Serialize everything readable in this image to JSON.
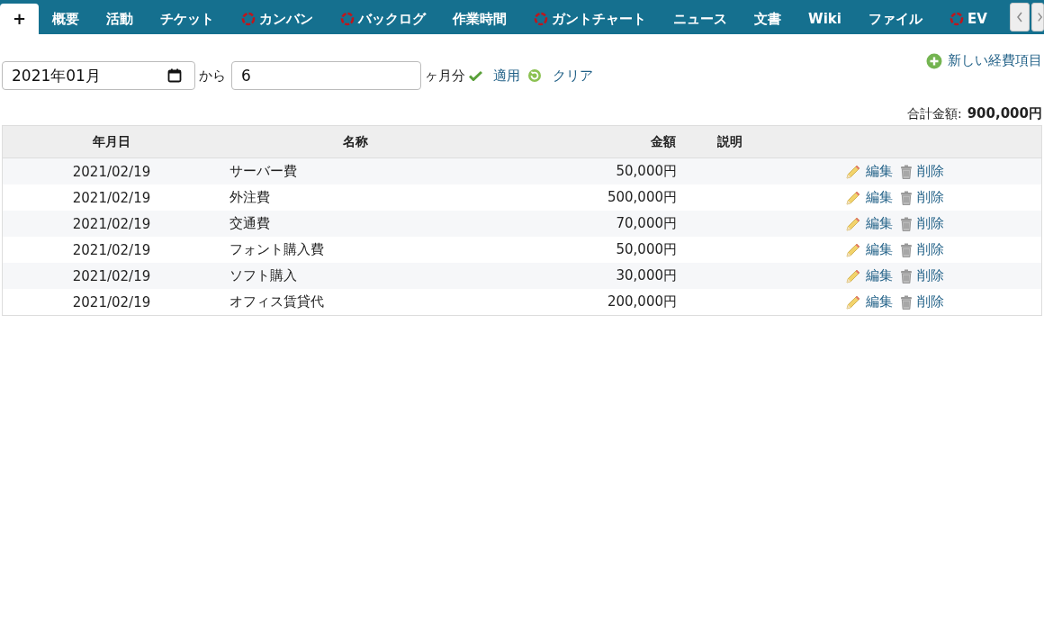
{
  "tabs": [
    {
      "label": "+",
      "kind": "plain",
      "selected": true
    },
    {
      "label": "概要",
      "kind": "plain",
      "selected": false
    },
    {
      "label": "活動",
      "kind": "plain",
      "selected": false
    },
    {
      "label": "チケット",
      "kind": "plain",
      "selected": false
    },
    {
      "label": "カンバン",
      "kind": "plugin",
      "selected": false
    },
    {
      "label": "バックログ",
      "kind": "plugin",
      "selected": false
    },
    {
      "label": "作業時間",
      "kind": "plain",
      "selected": false
    },
    {
      "label": "ガントチャート",
      "kind": "plugin",
      "selected": false
    },
    {
      "label": "ニュース",
      "kind": "plain",
      "selected": false
    },
    {
      "label": "文書",
      "kind": "plain",
      "selected": false
    },
    {
      "label": "Wiki",
      "kind": "plain",
      "selected": false
    },
    {
      "label": "ファイル",
      "kind": "plain",
      "selected": false
    },
    {
      "label": "EV",
      "kind": "plugin",
      "selected": false
    }
  ],
  "filter": {
    "start_month": "2021年01月",
    "from_label": "から",
    "months": "6",
    "months_suffix": "ヶ月分",
    "apply": "適用",
    "clear": "クリア"
  },
  "new_item": "新しい経費項目",
  "total": {
    "label": "合計金額:",
    "value": "900,000円"
  },
  "table": {
    "columns": [
      "年月日",
      "名称",
      "金額",
      "説明"
    ],
    "rows": [
      {
        "date": "2021/02/19",
        "name": "サーバー費",
        "amount": "50,000円",
        "edit": "編集",
        "delete": "削除"
      },
      {
        "date": "2021/02/19",
        "name": "外注費",
        "amount": "500,000円",
        "edit": "編集",
        "delete": "削除"
      },
      {
        "date": "2021/02/19",
        "name": "交通費",
        "amount": "70,000円",
        "edit": "編集",
        "delete": "削除"
      },
      {
        "date": "2021/02/19",
        "name": "フォント購入費",
        "amount": "50,000円",
        "edit": "編集",
        "delete": "削除"
      },
      {
        "date": "2021/02/19",
        "name": "ソフト購入",
        "amount": "30,000円",
        "edit": "編集",
        "delete": "削除"
      },
      {
        "date": "2021/02/19",
        "name": "オフィス賃貸代",
        "amount": "200,000円",
        "edit": "編集",
        "delete": "削除"
      }
    ]
  }
}
